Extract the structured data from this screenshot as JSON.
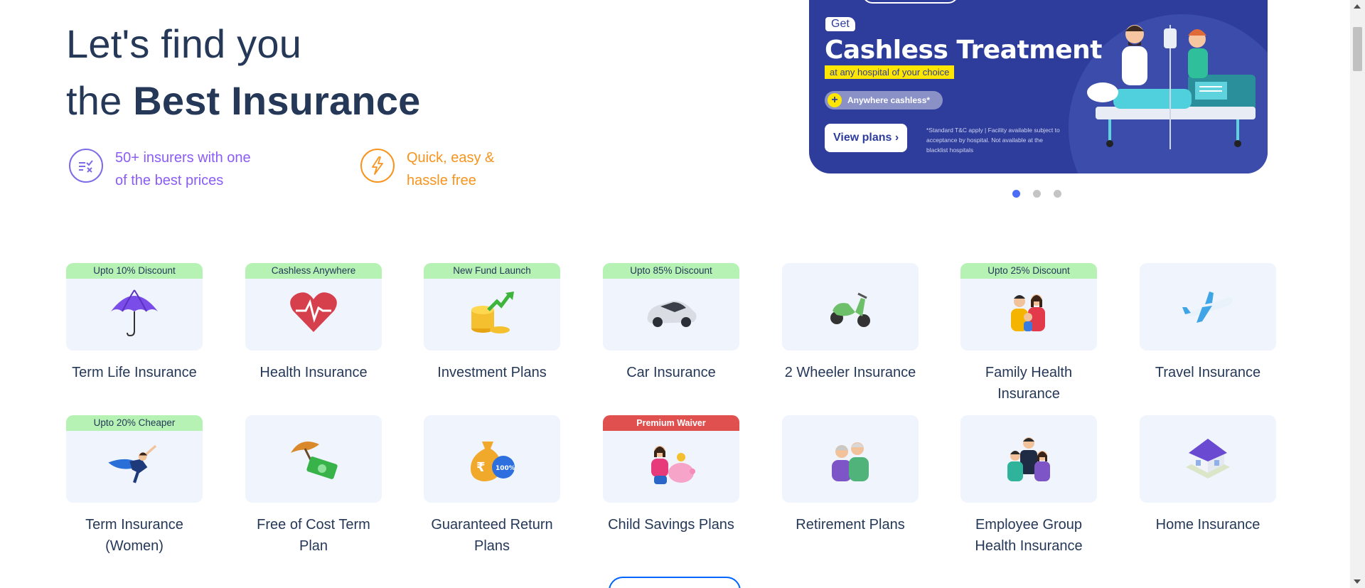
{
  "hero": {
    "line1": "Let's find you",
    "line2_prefix": "the",
    "line2_bold": "Best Insurance"
  },
  "usps": [
    {
      "line1": "50+ insurers with one",
      "line2": "of the best prices",
      "icon": "compare-icon",
      "color": "#8b5cf6"
    },
    {
      "line1": "Quick, easy &",
      "line2": "hassle free",
      "icon": "lightning-icon",
      "color": "#f7941d"
    }
  ],
  "banner": {
    "tag": "Get",
    "headline": "Cashless Treatment",
    "subline": "at any hospital of your choice",
    "pill": "Anywhere cashless*",
    "cta": "View plans  ›",
    "disclaimer": "*Standard T&C apply | Facility available subject to acceptance by hospital. Not available at the blacklist hospitals",
    "bg_color": "#2e3d9c"
  },
  "carousel": {
    "total": 3,
    "active": 1
  },
  "products": [
    {
      "name": "Term Life Insurance",
      "badge": "Upto 10% Discount",
      "icon": "umbrella-icon"
    },
    {
      "name": "Health Insurance",
      "badge": "Cashless Anywhere",
      "icon": "heart-pulse-icon"
    },
    {
      "name": "Investment Plans",
      "badge": "New Fund Launch",
      "icon": "coins-growth-icon"
    },
    {
      "name": "Car Insurance",
      "badge": "Upto 85% Discount",
      "icon": "car-icon"
    },
    {
      "name": "2 Wheeler Insurance",
      "badge": "",
      "icon": "scooter-icon"
    },
    {
      "name": "Family Health Insurance",
      "badge": "Upto 25% Discount",
      "icon": "family-icon"
    },
    {
      "name": "Travel Insurance",
      "badge": "",
      "icon": "airplane-icon"
    },
    {
      "name": "Term Insurance (Women)",
      "badge": "Upto 20% Cheaper",
      "icon": "superwoman-icon"
    },
    {
      "name": "Free of Cost Term Plan",
      "badge": "",
      "icon": "umbrella-money-icon"
    },
    {
      "name": "Guaranteed Return Plans",
      "badge": "",
      "icon": "money-bag-icon"
    },
    {
      "name": "Child Savings Plans",
      "badge": "Premium Waiver",
      "badge_style": "red",
      "icon": "piggy-bank-icon"
    },
    {
      "name": "Retirement Plans",
      "badge": "",
      "icon": "elderly-couple-icon"
    },
    {
      "name": "Employee Group Health Insurance",
      "badge": "",
      "icon": "employees-icon"
    },
    {
      "name": "Home Insurance",
      "badge": "",
      "icon": "house-icon"
    }
  ]
}
